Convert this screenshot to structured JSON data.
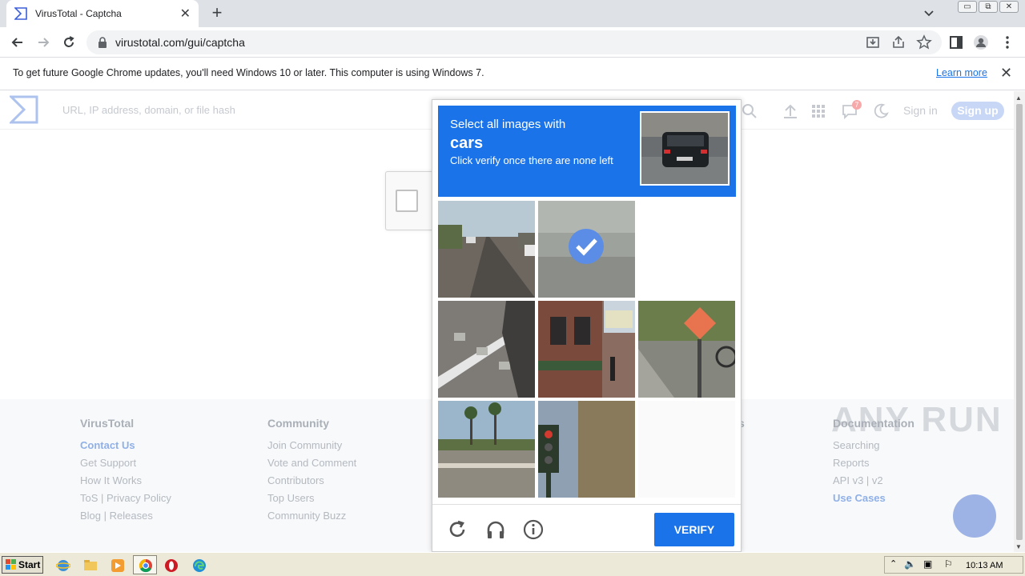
{
  "browser": {
    "tab_title": "VirusTotal - Captcha",
    "url": "virustotal.com/gui/captcha",
    "infobar_message": "To get future Google Chrome updates, you'll need Windows 10 or later. This computer is using Windows 7.",
    "infobar_link": "Learn more"
  },
  "header": {
    "search_placeholder": "URL, IP address, domain, or file hash",
    "notifications_count": "7",
    "signin": "Sign in",
    "signup": "Sign up"
  },
  "captcha": {
    "line1": "Select all images with",
    "line2": "cars",
    "line3": "Click verify once there are none left",
    "verify_label": "VERIFY"
  },
  "footer": {
    "col1": {
      "title": "VirusTotal",
      "items": [
        "Contact Us",
        "Get Support",
        "How It Works",
        "ToS | Privacy Policy",
        "Blog | Releases"
      ]
    },
    "col2": {
      "title": "Community",
      "items": [
        "Join Community",
        "Vote and Comment",
        "Contributors",
        "Top Users",
        "Community Buzz"
      ]
    },
    "col3_title_tail": "s",
    "col4": {
      "title": "Documentation",
      "items": [
        "Searching",
        "Reports",
        "API v3 | v2",
        "Use Cases"
      ]
    }
  },
  "watermark": "ANY RUN",
  "taskbar": {
    "start": "Start",
    "clock": "10:13 AM"
  }
}
